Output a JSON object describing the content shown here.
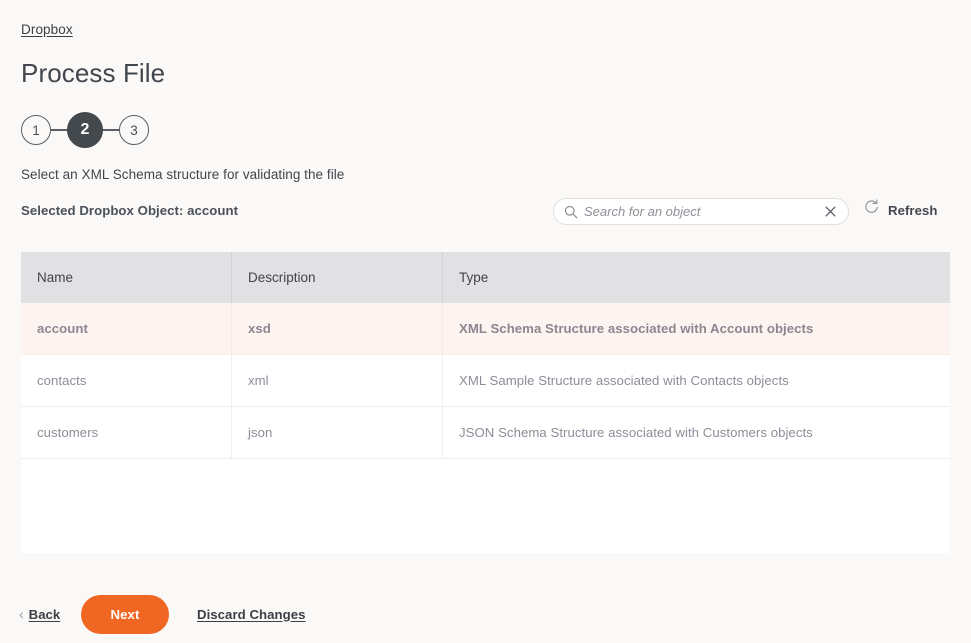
{
  "breadcrumb": {
    "label": "Dropbox"
  },
  "page": {
    "title": "Process File"
  },
  "stepper": {
    "steps": [
      {
        "number": "1",
        "state": "complete"
      },
      {
        "number": "2",
        "state": "active"
      },
      {
        "number": "3",
        "state": "upcoming"
      }
    ]
  },
  "instruction": {
    "text": "Select an XML Schema structure for validating the file"
  },
  "selected_object": {
    "text": "Selected Dropbox Object: account"
  },
  "search": {
    "value": "",
    "placeholder": "Search for an object",
    "icon": "search-icon",
    "clear_icon": "close-icon"
  },
  "refresh": {
    "label": "Refresh",
    "icon": "refresh-icon"
  },
  "table": {
    "columns": [
      {
        "key": "name",
        "label": "Name"
      },
      {
        "key": "description",
        "label": "Description"
      },
      {
        "key": "type",
        "label": "Type"
      }
    ],
    "rows": [
      {
        "name": "account",
        "description": "xsd",
        "type": "XML Schema Structure associated with Account objects",
        "selected": true
      },
      {
        "name": "contacts",
        "description": "xml",
        "type": "XML Sample Structure associated with Contacts objects",
        "selected": false
      },
      {
        "name": "customers",
        "description": "json",
        "type": "JSON Schema Structure associated with Customers objects",
        "selected": false
      }
    ]
  },
  "footer": {
    "back_label": "Back",
    "next_label": "Next",
    "discard_label": "Discard Changes"
  },
  "colors": {
    "accent_orange": "#f06623",
    "page_background": "#faf9f8",
    "step_active": "#44494d",
    "header_background": "#e1e0e2",
    "selected_row": "#fdf3f0"
  }
}
